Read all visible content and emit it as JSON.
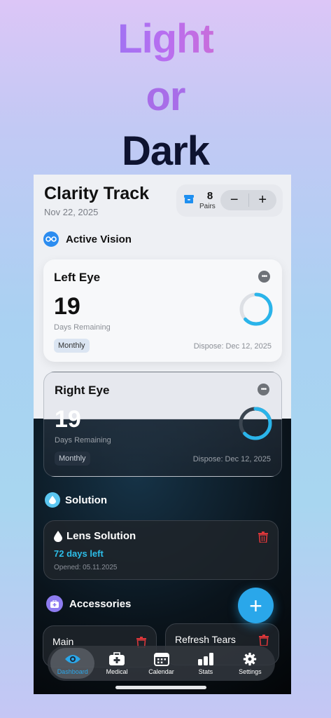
{
  "hero": {
    "line1": "Light",
    "line2": "or",
    "line3": "Dark"
  },
  "app": {
    "title": "Clarity Track",
    "date": "Nov 22, 2025",
    "stock": {
      "count": "8",
      "unit": "Pairs",
      "minus": "−",
      "plus": "+"
    }
  },
  "sections": {
    "vision": "Active Vision",
    "solution": "Solution",
    "accessories": "Accessories"
  },
  "left_eye": {
    "name": "Left Eye",
    "days": "19",
    "days_label": "Days Remaining",
    "type": "Monthly",
    "dispose": "Dispose: Dec 12, 2025",
    "progress": 0.63
  },
  "right_eye": {
    "name": "Right Eye",
    "days": "19",
    "days_label": "Days Remaining",
    "type": "Monthly",
    "dispose": "Dispose: Dec 12, 2025",
    "progress": 0.63
  },
  "solution": {
    "name": "Lens Solution",
    "days_left": "72 days left",
    "opened": "Opened: 05.11.2025"
  },
  "accessories": [
    {
      "name": "Main"
    },
    {
      "name": "Refresh Tears"
    }
  ],
  "fab": {
    "label": "+"
  },
  "tabs": [
    {
      "label": "Dashboard",
      "icon": "eye-icon"
    },
    {
      "label": "Medical",
      "icon": "medical-kit-icon"
    },
    {
      "label": "Calendar",
      "icon": "calendar-icon"
    },
    {
      "label": "Stats",
      "icon": "bar-chart-icon"
    },
    {
      "label": "Settings",
      "icon": "gear-icon"
    }
  ],
  "colors": {
    "accent": "#2aa7ea",
    "danger": "#d9373a",
    "purple": "#8e7cf0"
  }
}
